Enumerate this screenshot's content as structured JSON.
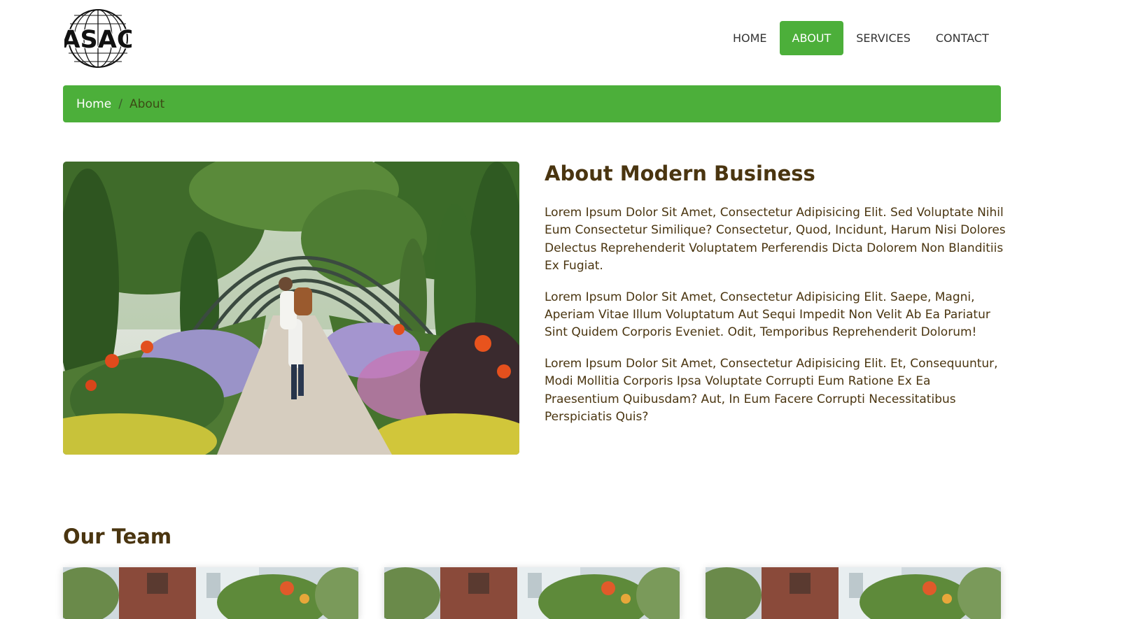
{
  "brand": {
    "logo_text": "ASAC"
  },
  "nav": {
    "items": [
      {
        "label": "HOME",
        "active": false
      },
      {
        "label": "ABOUT",
        "active": true
      },
      {
        "label": "SERVICES",
        "active": false
      },
      {
        "label": "CONTACT",
        "active": false
      }
    ]
  },
  "breadcrumb": {
    "home": "Home",
    "separator": "/",
    "current": "About"
  },
  "about": {
    "title": "About Modern Business",
    "paragraphs": [
      "Lorem Ipsum Dolor Sit Amet, Consectetur Adipisicing Elit. Sed Voluptate Nihil Eum Consectetur Similique? Consectetur, Quod, Incidunt, Harum Nisi Dolores Delectus Reprehenderit Voluptatem Perferendis Dicta Dolorem Non Blanditiis Ex Fugiat.",
      "Lorem Ipsum Dolor Sit Amet, Consectetur Adipisicing Elit. Saepe, Magni, Aperiam Vitae Illum Voluptatum Aut Sequi Impedit Non Velit Ab Ea Pariatur Sint Quidem Corporis Eveniet. Odit, Temporibus Reprehenderit Dolorum!",
      "Lorem Ipsum Dolor Sit Amet, Consectetur Adipisicing Elit. Et, Consequuntur, Modi Mollitia Corporis Ipsa Voluptate Corrupti Eum Ratione Ex Ea Praesentium Quibusdam? Aut, In Eum Facere Corrupti Necessitatibus Perspiciatis Quis?"
    ]
  },
  "team": {
    "title": "Our Team"
  },
  "colors": {
    "accent": "#4caf3a",
    "heading": "#4a3510",
    "text": "#4a3510"
  }
}
